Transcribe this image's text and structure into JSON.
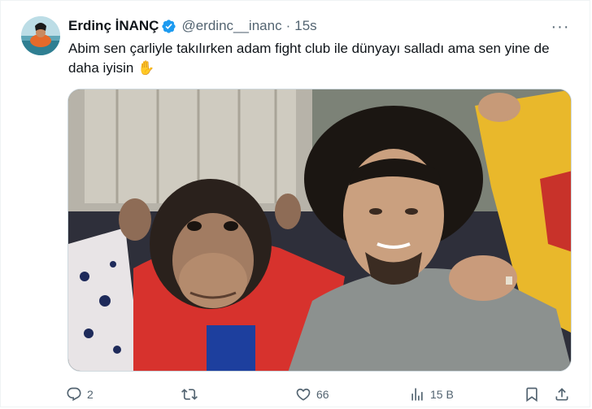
{
  "tweet": {
    "display_name": "Erdinç İNANÇ",
    "handle": "@erdinc__inanc",
    "separator": "·",
    "time": "15s",
    "more_label": "···",
    "text": "Abim sen çarliyle takılırken adam fight club ile dünyayı salladı ama sen yine de daha iyisin ✋",
    "verified_icon": "verified-badge-icon",
    "colors": {
      "text": "#0f1419",
      "secondary": "#536471",
      "verified": "#1d9bf0",
      "border": "#eff3f4"
    }
  },
  "actions": {
    "reply": {
      "icon": "reply-icon",
      "count": "2"
    },
    "repost": {
      "icon": "repost-icon",
      "count": ""
    },
    "like": {
      "icon": "heart-icon",
      "count": "66"
    },
    "views": {
      "icon": "views-icon",
      "count": "15 B"
    },
    "bookmark": {
      "icon": "bookmark-icon"
    },
    "share": {
      "icon": "share-icon"
    }
  }
}
